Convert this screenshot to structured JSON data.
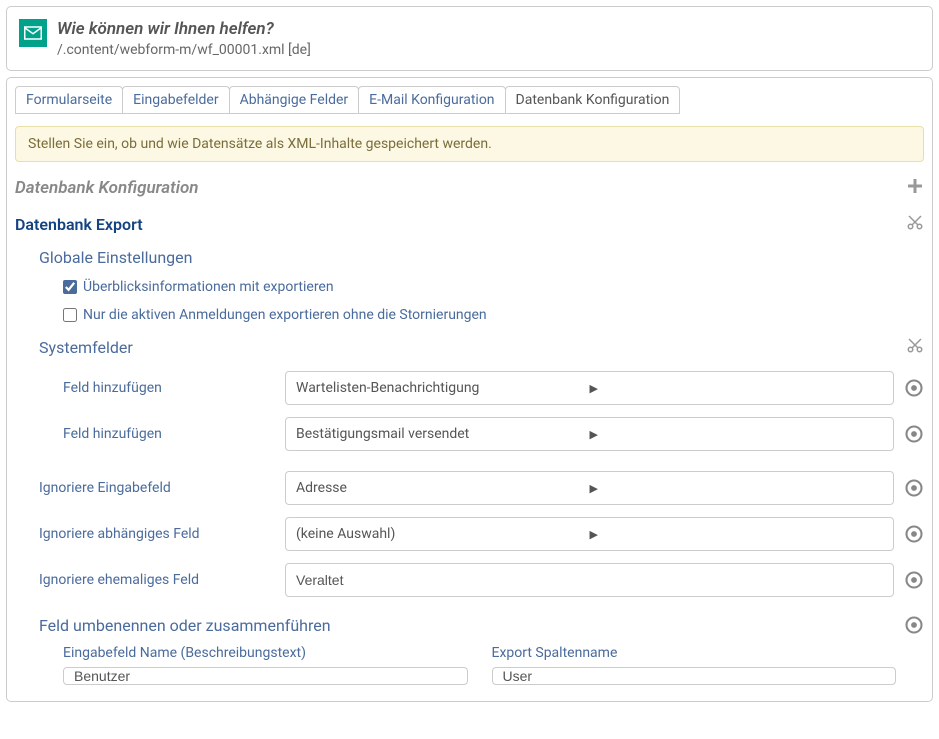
{
  "header": {
    "title": "Wie können wir Ihnen helfen?",
    "path": "/.content/webform-m/wf_00001.xml [de]"
  },
  "tabs": [
    "Formularseite",
    "Eingabefelder",
    "Abhängige Felder",
    "E-Mail Konfiguration",
    "Datenbank Konfiguration"
  ],
  "helpText": "Stellen Sie ein, ob und wie Datensätze als XML-Inhalte gespeichert werden.",
  "sections": {
    "dbConfig": "Datenbank Konfiguration",
    "dbExport": "Datenbank Export",
    "global": "Globale Einstellungen",
    "checkbox1": "Überblicksinformationen mit exportieren",
    "checkbox2": "Nur die aktiven Anmeldungen exportieren ohne die Stornierungen",
    "sysFields": "Systemfelder",
    "addField": "Feld hinzufügen",
    "sysValue1": "Wartelisten-Benachrichtigung",
    "sysValue2": "Bestätigungsmail versendet",
    "ignoreInput": "Ignoriere Eingabefeld",
    "ignoreInputVal": "Adresse",
    "ignoreDep": "Ignoriere abhängiges Feld",
    "ignoreDepVal": "(keine Auswahl)",
    "ignoreFormer": "Ignoriere ehemaliges Feld",
    "ignoreFormerVal": "Veraltet",
    "rename": "Feld umbenennen oder zusammenführen",
    "renameInputLabel": "Eingabefeld Name (Beschreibungstext)",
    "renameInputVal": "Benutzer",
    "renameExportLabel": "Export Spaltenname",
    "renameExportVal": "User"
  }
}
